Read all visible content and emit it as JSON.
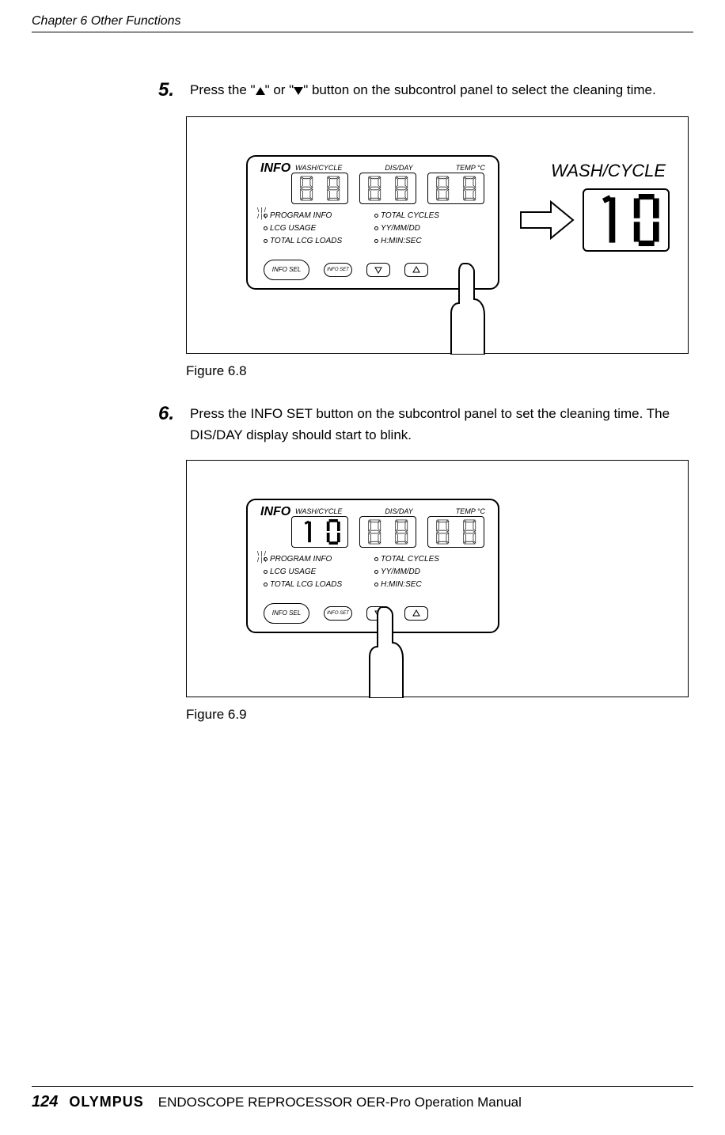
{
  "header": "Chapter 6  Other Functions",
  "steps": {
    "5": {
      "num": "5.",
      "text_pre": "Press the \"",
      "text_mid": "\" or \"",
      "text_post": "\" button on the subcontrol panel to select the cleaning time."
    },
    "6": {
      "num": "6.",
      "text": "Press the INFO SET button on the subcontrol panel to set the cleaning time. The DIS/DAY display should start to blink."
    }
  },
  "figure": {
    "fig68": "Figure 6.8",
    "fig69": "Figure 6.9"
  },
  "panel": {
    "title": "INFO",
    "wash_cycle": "WASH/CYCLE",
    "dis_day": "DIS/DAY",
    "temp": "TEMP °C",
    "program_info": "PROGRAM INFO",
    "total_cycles": "TOTAL CYCLES",
    "lcg_usage": "LCG  USAGE",
    "yy_mm_dd": "YY/MM/DD",
    "total_lcg_loads": "TOTAL LCG LOADS",
    "h_min_sec": "H:MIN:SEC",
    "info_sel": "INFO SEL",
    "info_set": "INFO SET"
  },
  "callout": {
    "title": "WASH/CYCLE",
    "value": "10"
  },
  "footer": {
    "page": "124",
    "brand": "OLYMPUS",
    "manual": "ENDOSCOPE REPROCESSOR OER-Pro Operation Manual"
  }
}
